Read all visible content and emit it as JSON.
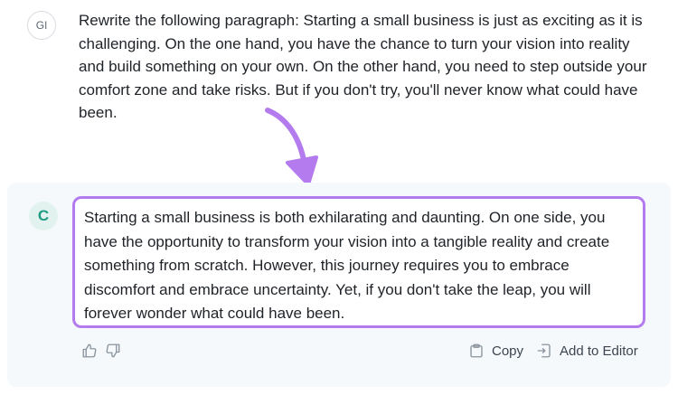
{
  "user": {
    "avatar_initials": "Gl",
    "message": "Rewrite the following paragraph: Starting a small business is just as exciting as it is challenging. On the one hand, you have the chance to turn your vision into reality and build something on your own. On the other hand, you need to step outside your comfort zone and take risks. But if you don't try, you'll never know what could have been."
  },
  "assistant": {
    "avatar_initial": "C",
    "response": "Starting a small business is both exhilarating and daunting. On one side, you have the opportunity to transform your vision into a tangible reality and create something from scratch. However, this journey requires you to embrace discomfort and embrace uncertainty. Yet, if you don't take the leap, you will forever wonder what could have been."
  },
  "actions": {
    "thumbs_up_icon": "thumbs-up-icon",
    "thumbs_down_icon": "thumbs-down-icon",
    "copy_label": "Copy",
    "add_to_editor_label": "Add to Editor"
  },
  "colors": {
    "highlight_border": "#b37bee",
    "arrow": "#b37bee",
    "panel_background": "#f5f9fb",
    "bot_avatar_text": "#1e9b82"
  }
}
